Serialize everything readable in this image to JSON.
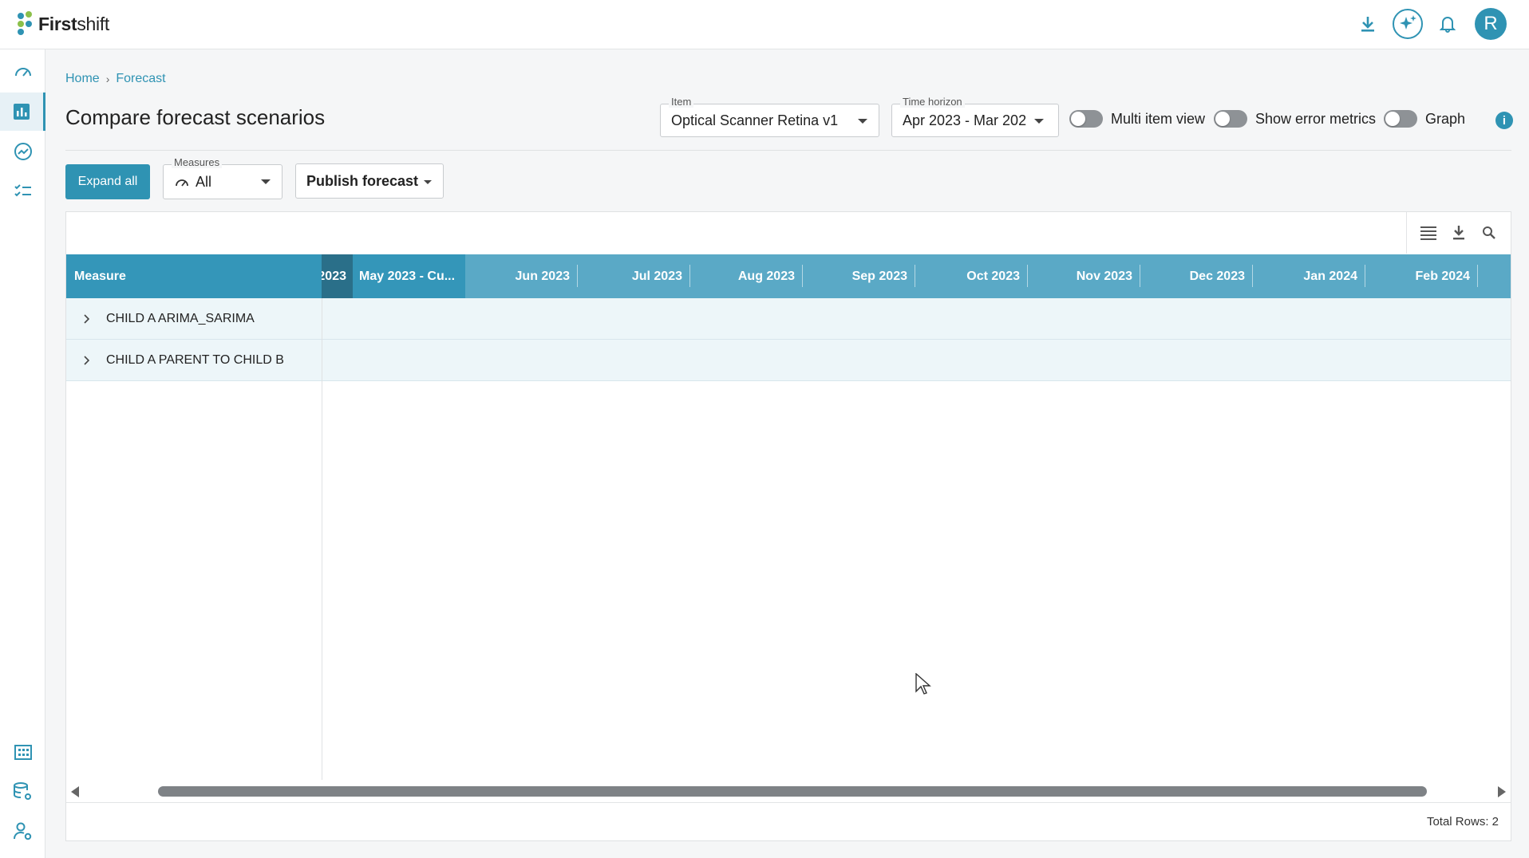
{
  "app": {
    "brand_bold": "First",
    "brand_rest": "shift",
    "avatar_initial": "R"
  },
  "breadcrumb": [
    "Home",
    "Forecast"
  ],
  "page": {
    "title": "Compare forecast scenarios"
  },
  "filters": {
    "item": {
      "label": "Item",
      "value": "Optical Scanner Retina v1"
    },
    "time_horizon": {
      "label": "Time horizon",
      "value": "Apr 2023 - Mar 202"
    },
    "toggles": [
      {
        "label": "Multi item view",
        "on": false
      },
      {
        "label": "Show error metrics",
        "on": false
      },
      {
        "label": "Graph",
        "on": false
      }
    ]
  },
  "actions": {
    "expand_all": "Expand all",
    "measures": {
      "label": "Measures",
      "value": "All"
    },
    "publish": "Publish forecast"
  },
  "grid": {
    "measure_header": "Measure",
    "columns": [
      "2023",
      "May 2023 - Cu...",
      "Jun 2023",
      "Jul 2023",
      "Aug 2023",
      "Sep 2023",
      "Oct 2023",
      "Nov 2023",
      "Dec 2023",
      "Jan 2024",
      "Feb 2024"
    ],
    "rows": [
      {
        "label": "CHILD A ARIMA_SARIMA"
      },
      {
        "label": "CHILD A PARENT TO CHILD B"
      }
    ],
    "footer": "Total Rows: 2"
  },
  "colors": {
    "accent": "#2f93b3",
    "header_dark": "#3496b9",
    "header_light": "#5aa9c6",
    "header_pinned": "#2a6f89",
    "row_bg": "#edf6f9"
  }
}
